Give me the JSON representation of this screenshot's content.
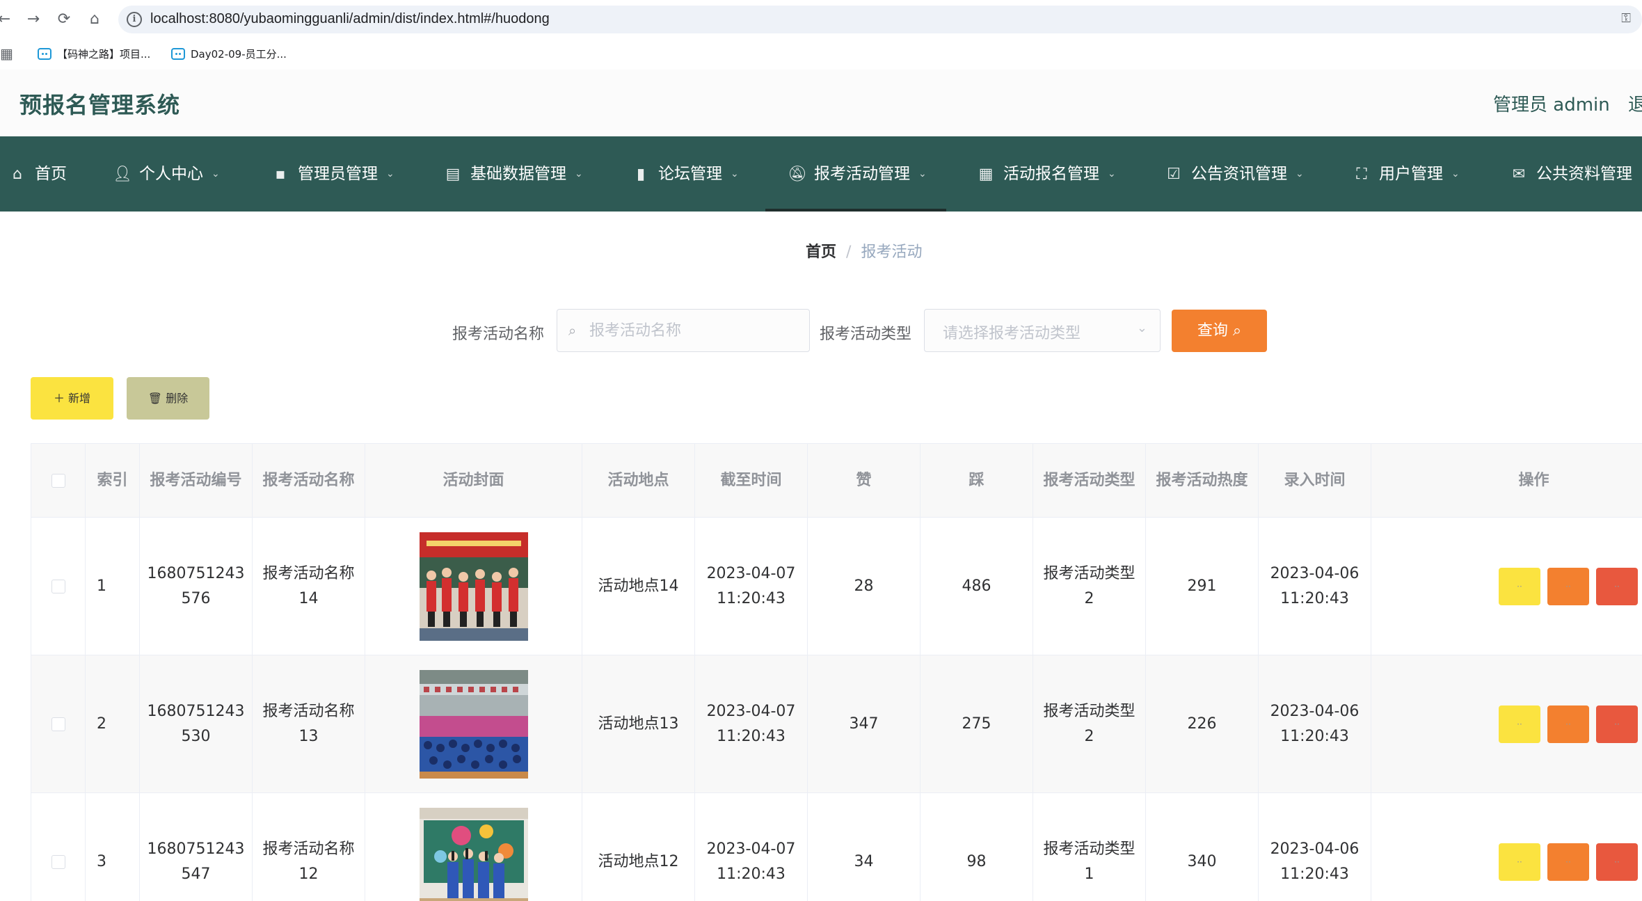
{
  "browser": {
    "url": "localhost:8080/yubaomingguanli/admin/dist/index.html#/huodong",
    "bookmarks": [
      "【码神之路】项目...",
      "Day02-09-员工分..."
    ]
  },
  "header": {
    "title": "预报名管理系统",
    "user_label": "管理员 admin",
    "logout_label": "退"
  },
  "nav": {
    "items": [
      {
        "label": "首页",
        "icon": "home-icon",
        "dropdown": false
      },
      {
        "label": "个人中心",
        "icon": "user-icon",
        "dropdown": true
      },
      {
        "label": "管理员管理",
        "icon": "chat-icon",
        "dropdown": true
      },
      {
        "label": "基础数据管理",
        "icon": "clipboard-icon",
        "dropdown": true
      },
      {
        "label": "论坛管理",
        "icon": "book-icon",
        "dropdown": true
      },
      {
        "label": "报考活动管理",
        "icon": "bell-off-icon",
        "dropdown": true
      },
      {
        "label": "活动报名管理",
        "icon": "grid-icon",
        "dropdown": true
      },
      {
        "label": "公告资讯管理",
        "icon": "clipboard-check-icon",
        "dropdown": true
      },
      {
        "label": "用户管理",
        "icon": "fullscreen-icon",
        "dropdown": true
      },
      {
        "label": "公共资料管理",
        "icon": "mail-icon",
        "dropdown": false
      }
    ],
    "active": "报考活动管理"
  },
  "breadcrumb": {
    "home": "首页",
    "separator": "/",
    "current": "报考活动"
  },
  "search": {
    "name_label": "报考活动名称",
    "name_placeholder": "报考活动名称",
    "name_value": "",
    "type_label": "报考活动类型",
    "type_placeholder": "请选择报考活动类型",
    "query_label": "查询"
  },
  "actions": {
    "add_label": "新增",
    "delete_label": "删除"
  },
  "table": {
    "columns": [
      "",
      "索引",
      "报考活动编号",
      "报考活动名称",
      "活动封面",
      "活动地点",
      "截至时间",
      "赞",
      "踩",
      "报考活动类型",
      "报考活动热度",
      "录入时间",
      "操作"
    ],
    "rows": [
      {
        "index": "1",
        "number": "1680751243576",
        "name": "报考活动名称14",
        "location": "活动地点14",
        "deadline": "2023-04-07 11:20:43",
        "likes": "28",
        "dislikes": "486",
        "type": "报考活动类型2",
        "heat": "291",
        "created": "2023-04-06 11:20:43"
      },
      {
        "index": "2",
        "number": "1680751243530",
        "name": "报考活动名称13",
        "location": "活动地点13",
        "deadline": "2023-04-07 11:20:43",
        "likes": "347",
        "dislikes": "275",
        "type": "报考活动类型2",
        "heat": "226",
        "created": "2023-04-06 11:20:43"
      },
      {
        "index": "3",
        "number": "1680751243547",
        "name": "报考活动名称12",
        "location": "活动地点12",
        "deadline": "2023-04-07 11:20:43",
        "likes": "34",
        "dislikes": "98",
        "type": "报考活动类型1",
        "heat": "340",
        "created": "2023-04-06 11:20:43"
      }
    ]
  },
  "colors": {
    "nav_bg": "#2e5a55",
    "query": "#f3802f",
    "add": "#fbe340",
    "delete": "#c8c898",
    "op_view": "#fbe340",
    "op_edit": "#f3802f",
    "op_delete": "#e8583e"
  }
}
